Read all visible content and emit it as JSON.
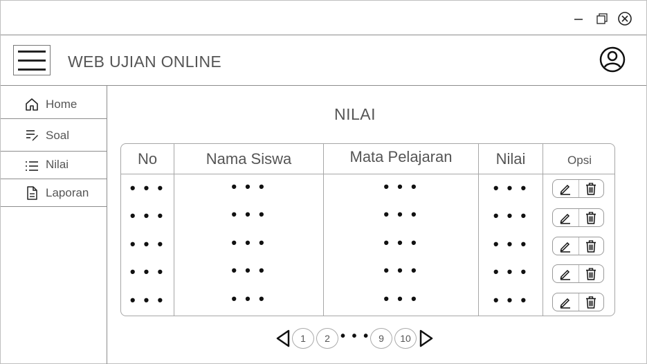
{
  "app": {
    "title": "WEB UJIAN ONLINE"
  },
  "sidebar": {
    "items": [
      {
        "label": "Home",
        "icon": "home-icon"
      },
      {
        "label": "Soal",
        "icon": "edit-list-icon"
      },
      {
        "label": "Nilai",
        "icon": "list-icon"
      },
      {
        "label": "Laporan",
        "icon": "document-icon"
      }
    ]
  },
  "main": {
    "title": "NILAI",
    "table": {
      "headers": [
        "No",
        "Nama Siswa",
        "Mata Pelajaran",
        "Nilai",
        "Opsi"
      ],
      "rows": [
        [
          "• • •",
          "• • •",
          "• • •",
          "• • •"
        ],
        [
          "• • •",
          "• • •",
          "• • •",
          "• • •"
        ],
        [
          "• • •",
          "• • •",
          "• • •",
          "• • •"
        ],
        [
          "• • •",
          "• • •",
          "• • •",
          "• • •"
        ],
        [
          "• • •",
          "• • •",
          "• • •",
          "• • •"
        ]
      ],
      "actions": [
        "edit-icon",
        "trash-icon"
      ]
    },
    "pagination": {
      "pages": [
        "1",
        "2",
        "9",
        "10"
      ],
      "ellipsis": "• • •"
    }
  }
}
